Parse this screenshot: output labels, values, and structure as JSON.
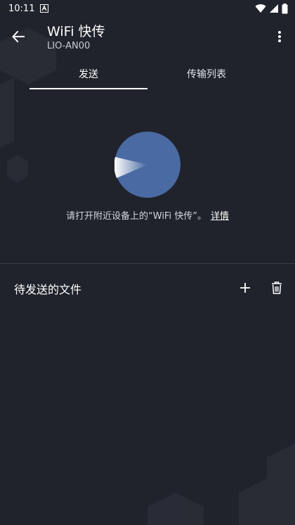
{
  "status": {
    "time": "10:11",
    "left_icons": [
      "notification-a-icon"
    ],
    "right_icons": [
      "wifi-icon",
      "signal-icon",
      "battery-icon"
    ]
  },
  "appbar": {
    "title": "WiFi 快传",
    "subtitle": "LIO-AN00",
    "back_icon": "back-arrow-icon",
    "more_icon": "more-vertical-icon"
  },
  "tabs": [
    {
      "label": "发送",
      "selected": true
    },
    {
      "label": "传输列表",
      "selected": false
    }
  ],
  "main": {
    "hint": "请打开附近设备上的“WiFi 快传”。",
    "hint_link": "详情",
    "radar_color": "#4a6aa3"
  },
  "pending": {
    "title": "待发送的文件",
    "add_icon": "plus-icon",
    "delete_icon": "trash-icon"
  },
  "colors": {
    "background": "#20232b",
    "accent": "#4a6aa3",
    "text": "#ffffff"
  }
}
